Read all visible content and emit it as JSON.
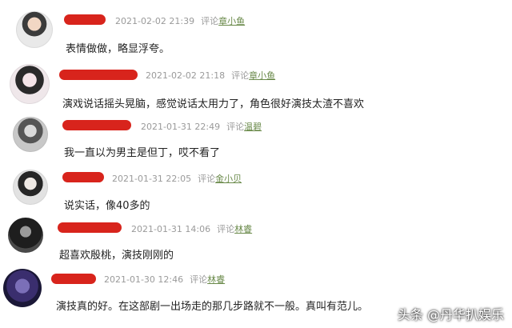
{
  "comments": [
    {
      "time": "2021-02-02 21:39",
      "reply_label": "评论",
      "reply_to": "章小鱼",
      "text": "表情做做，略显浮夸。"
    },
    {
      "time": "2021-02-02 21:18",
      "reply_label": "评论",
      "reply_to": "章小鱼",
      "text": "演戏说话摇头晃脑，感觉说话太用力了，角色很好演技太渣不喜欢"
    },
    {
      "time": "2021-01-31 22:49",
      "reply_label": "评论",
      "reply_to": "温碧",
      "text": "我一直以为男主是但丁，哎不看了"
    },
    {
      "time": "2021-01-31 22:05",
      "reply_label": "评论",
      "reply_to": "金小贝",
      "text": "说实话，像40多的"
    },
    {
      "time": "2021-01-31 14:06",
      "reply_label": "评论",
      "reply_to": "林睿",
      "text": "超喜欢殷桃，演技刚刚的"
    },
    {
      "time": "2021-01-30 12:46",
      "reply_label": "评论",
      "reply_to": "林睿",
      "text": "演技真的好。在这部剧一出场走的那几步路就不一般。真叫有范儿。"
    }
  ],
  "watermark": "头条 @丹华扒娱乐"
}
